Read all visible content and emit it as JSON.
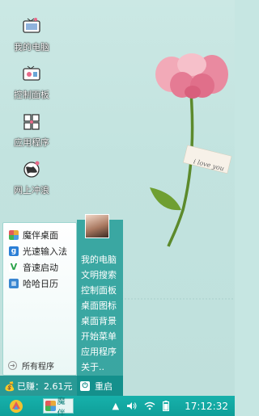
{
  "desktop": {
    "icons": [
      {
        "label": "我的电脑",
        "icon": "my-computer-icon"
      },
      {
        "label": "控制面板",
        "icon": "control-panel-icon"
      },
      {
        "label": "应用程序",
        "icon": "applications-icon"
      },
      {
        "label": "网上冲浪",
        "icon": "internet-icon"
      }
    ],
    "wallpaper_card_text": "i love you"
  },
  "start_menu": {
    "apps": [
      {
        "label": "魔伴桌面",
        "icon": "mobanzhuomian-icon",
        "color": "#e8a93a"
      },
      {
        "label": "光速输入法",
        "icon": "guangsu-input-icon",
        "color": "#2b7fd6"
      },
      {
        "label": "音速启动",
        "icon": "yinsu-launcher-icon",
        "color": "#2aa34a"
      },
      {
        "label": "哈哈日历",
        "icon": "haha-calendar-icon",
        "color": "#3a86d1"
      }
    ],
    "all_programs": "所有程序",
    "shortcuts": [
      "我的电脑",
      "文明搜索",
      "控制面板",
      "桌面图标",
      "桌面背景",
      "开始菜单",
      "应用程序",
      "关于.."
    ],
    "earned": "已赚：2.61元",
    "restart": "重启"
  },
  "taskbar": {
    "task_label": "魔伴",
    "clock": "17:12:32",
    "tray_icons": [
      "up-arrow-icon",
      "volume-icon",
      "wifi-icon",
      "battery-icon"
    ]
  },
  "colors": {
    "accent": "#12a59f",
    "wallpaper": "#c6e6e2"
  }
}
